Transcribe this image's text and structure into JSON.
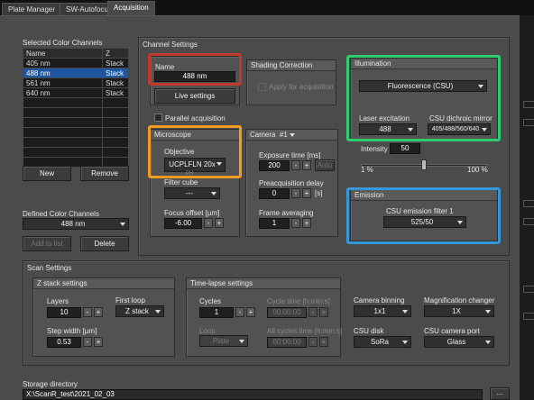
{
  "tabs": [
    "Plate Manager",
    "SW-Autofocus",
    "Acquisition"
  ],
  "active_tab": 2,
  "selected_channels": {
    "title": "Selected Color Channels",
    "columns": [
      "Name",
      "Z"
    ],
    "rows": [
      {
        "name": "405 nm",
        "z": "Stack"
      },
      {
        "name": "488 nm",
        "z": "Stack"
      },
      {
        "name": "561 nm",
        "z": "Stack"
      },
      {
        "name": "640 nm",
        "z": "Stack"
      }
    ],
    "selected_index": 1,
    "new_label": "New",
    "remove_label": "Remove"
  },
  "defined_channels": {
    "title": "Defined Color Channels",
    "value": "488 nm",
    "add_label": "Add to list",
    "delete_label": "Delete"
  },
  "channel_settings": {
    "title": "Channel Settings",
    "name": {
      "title": "Name",
      "value": "488 nm",
      "live_label": "Live settings"
    },
    "shading": {
      "title": "Shading Correction",
      "apply_label": "Apply for acquisition"
    },
    "parallel_label": "Parallel acquisition",
    "microscope": {
      "title": "Microscope",
      "objective_label": "Objective",
      "objective_value": "UCPLFLN 20x",
      "objective_extra": "PH",
      "filter_label": "Filter cube",
      "filter_value": "---",
      "focus_label": "Focus offset [µm]",
      "focus_value": "-6.00"
    },
    "camera": {
      "title": "Camera",
      "camera_id": "#1",
      "exposure_label": "Exposure time [ms]",
      "exposure_value": "200",
      "auto_label": "Auto",
      "preacq_label": "Preacquisition delay",
      "preacq_value": "0",
      "preacq_unit": "[s]",
      "averaging_label": "Frame averaging",
      "averaging_value": "1"
    },
    "illumination": {
      "title": "Illumination",
      "mode_value": "Fluorescence (CSU)",
      "laser_label": "Laser excitation",
      "laser_value": "488",
      "dichroic_label": "CSU dichroic mirror",
      "dichroic_value": "405/488/560/640",
      "intensity_label": "Intensity",
      "intensity_value": "50",
      "intensity_fraction": 0.5,
      "min_label": "1 %",
      "max_label": "100 %"
    },
    "emission": {
      "title": "Emission",
      "filter_label": "CSU emission filter 1",
      "filter_value": "525/50"
    }
  },
  "scan_settings": {
    "title": "Scan Settings",
    "zstack": {
      "title": "Z stack settings",
      "layers_label": "Layers",
      "layers_value": "10",
      "first_loop_label": "First loop",
      "first_loop_value": "Z stack",
      "step_label": "Step width [µm]",
      "step_value": "0.53"
    },
    "timelapse": {
      "title": "Time-lapse settings",
      "cycles_label": "Cycles",
      "cycles_value": "1",
      "cycle_time_label": "Cycle time [h:min:s]",
      "cycle_time_value": "00:00:00",
      "loop_label": "Loop",
      "loop_value": "Plate",
      "all_cycles_label": "All cycles time [h:min:s]",
      "all_cycles_value": "00:00:00"
    },
    "camera_binning_label": "Camera binning",
    "camera_binning_value": "1x1",
    "mag_changer_label": "Magnification changer",
    "mag_changer_value": "1X",
    "csu_disk_label": "CSU disk",
    "csu_disk_value": "SoRa",
    "csu_port_label": "CSU camera port",
    "csu_port_value": "Glass"
  },
  "storage": {
    "label": "Storage directory",
    "value": "X:\\ScanR_test\\2021_02_03",
    "browse_label": "..."
  },
  "colors": {
    "highlight_name": "#c0392b",
    "highlight_microscope": "#f39c24",
    "highlight_illumination": "#2ecc71",
    "highlight_emission": "#3498db",
    "selection": "#1f56a0"
  }
}
